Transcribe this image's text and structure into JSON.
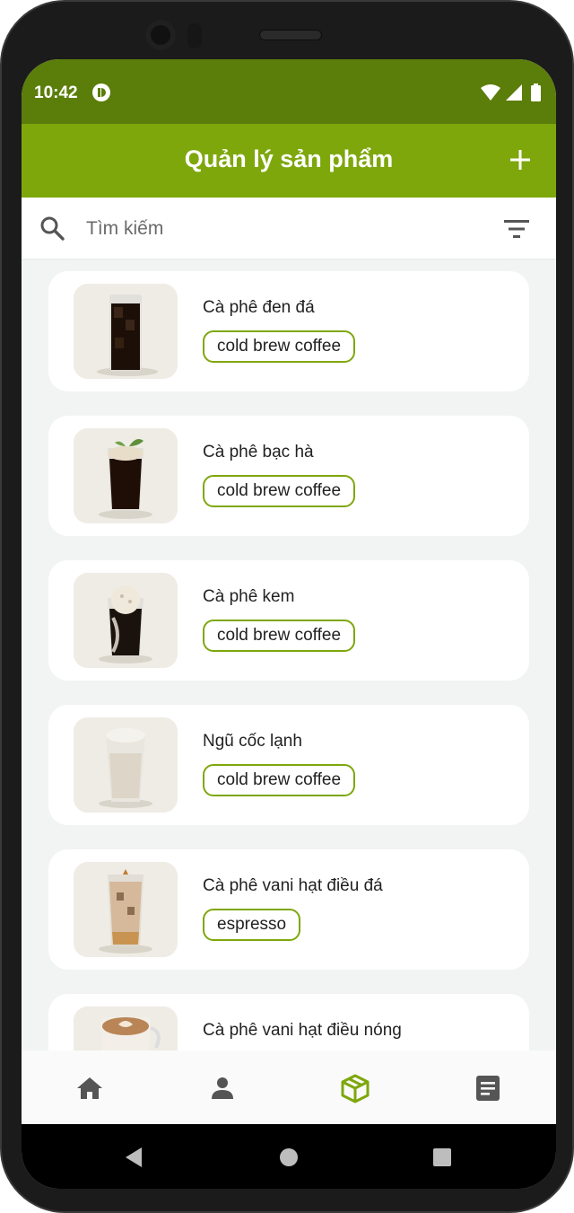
{
  "status_bar": {
    "time": "10:42"
  },
  "header": {
    "title": "Quản lý sản phẩm"
  },
  "search": {
    "placeholder": "Tìm kiếm"
  },
  "products": [
    {
      "name": "Cà phê đen đá",
      "category": "cold brew coffee",
      "image": "iced-black-coffee"
    },
    {
      "name": "Cà phê bạc hà",
      "category": "cold brew coffee",
      "image": "mint-coffee"
    },
    {
      "name": "Cà phê kem",
      "category": "cold brew coffee",
      "image": "coffee-float"
    },
    {
      "name": "Ngũ cốc lạnh",
      "category": "cold brew coffee",
      "image": "cereal-frappe"
    },
    {
      "name": "Cà phê vani hạt điều đá",
      "category": "espresso",
      "image": "iced-vanilla-latte"
    },
    {
      "name": "Cà phê vani hạt điều nóng",
      "category": "",
      "image": "hot-latte"
    }
  ],
  "bottom_nav": [
    {
      "icon": "home-icon",
      "active": false
    },
    {
      "icon": "person-icon",
      "active": false
    },
    {
      "icon": "box-icon",
      "active": true
    },
    {
      "icon": "document-icon",
      "active": false
    }
  ],
  "colors": {
    "status_bar": "#5b7d0a",
    "app_bar": "#7ea70c",
    "accent": "#7ea70c",
    "background": "#f2f4f3",
    "nav_inactive": "#555555"
  }
}
